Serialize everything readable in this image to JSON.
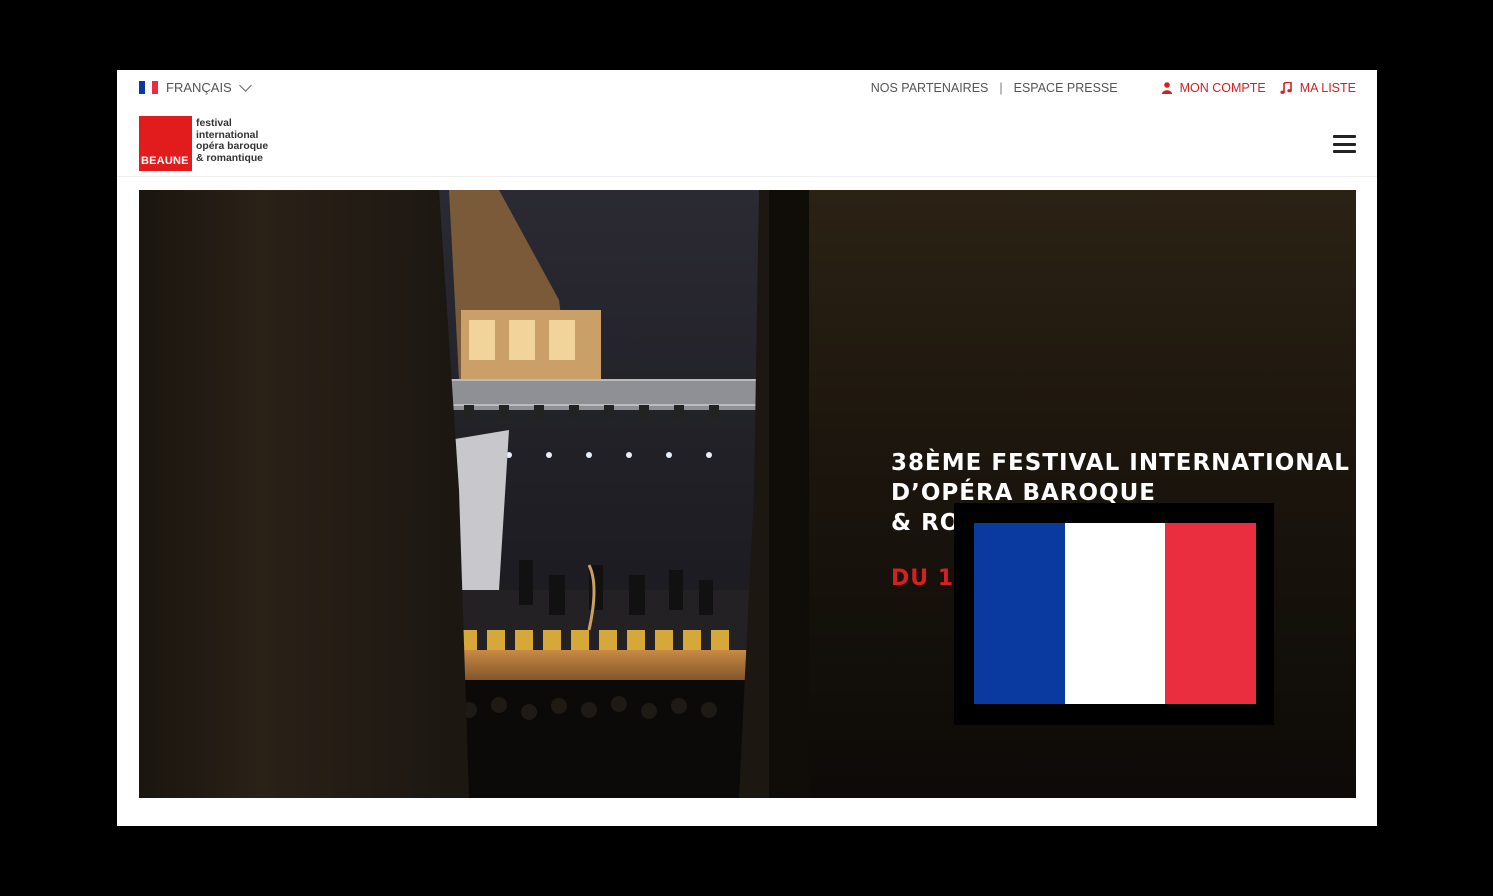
{
  "language": {
    "label": "FRANÇAIS",
    "flag_colors": [
      "#0a39a0",
      "#ffffff",
      "#ea2d3f"
    ]
  },
  "top_links": {
    "partners": "NOS PARTENAIRES",
    "separator": "|",
    "press": "ESPACE PRESSE",
    "account": "MON COMPTE",
    "my_list": "MA LISTE"
  },
  "logo": {
    "badge": "BEAUNE",
    "lines": [
      "festival",
      "international",
      "opéra baroque",
      "& romantique"
    ]
  },
  "hero": {
    "title_lines": [
      "38ÈME FESTIVAL INTERNATIONAL",
      "D’OPÉRA BAROQUE",
      "& ROI"
    ],
    "date": "DU 10"
  },
  "colors": {
    "accent": "#d32020",
    "logo_red": "#e21c1c"
  },
  "icons": {
    "account": "user-icon",
    "list": "music-note-icon",
    "menu": "hamburger-icon",
    "language": "chevron-down-icon"
  }
}
